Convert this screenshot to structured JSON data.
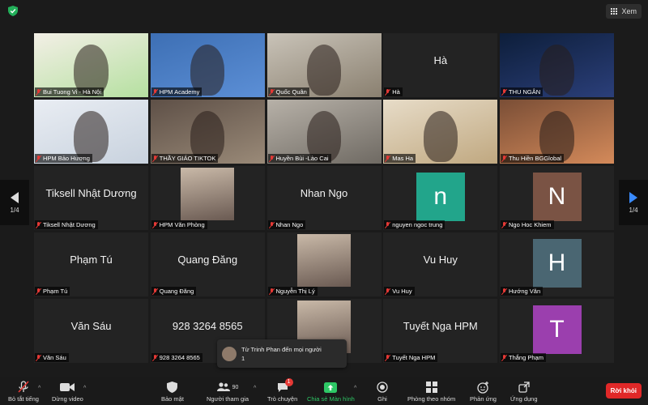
{
  "top_bar": {
    "view_label": "Xem"
  },
  "pager": {
    "left": "1/4",
    "right": "1/4"
  },
  "tiles": [
    {
      "name": "Bui Tuong Vi - Hà Nội",
      "kind": "video"
    },
    {
      "name": "HPM Academy",
      "kind": "video"
    },
    {
      "name": "Quốc Quân",
      "kind": "video"
    },
    {
      "name": "Hà",
      "kind": "text",
      "display": "Hà"
    },
    {
      "name": "THU NGÂN",
      "kind": "video"
    },
    {
      "name": "HPM Bảo Hương",
      "kind": "video"
    },
    {
      "name": "THẦY GIÁO TIKTOK",
      "kind": "video",
      "active": true
    },
    {
      "name": "Huyền Bùi -Lào Cai",
      "kind": "video"
    },
    {
      "name": "Mas Ha",
      "kind": "video"
    },
    {
      "name": "Thu Hiền BGGlobal",
      "kind": "video"
    },
    {
      "name": "Tiksell Nhật Dương",
      "kind": "text",
      "display": "Tiksell Nhật Dương"
    },
    {
      "name": "HPM Văn Phòng",
      "kind": "photo"
    },
    {
      "name": "Nhan Ngo",
      "kind": "text",
      "display": "Nhan Ngo"
    },
    {
      "name": "nguyen ngoc trung",
      "kind": "avatar",
      "letter": "n",
      "color": "#22a58b"
    },
    {
      "name": "Ngo Hoc Khiem",
      "kind": "avatar",
      "letter": "N",
      "color": "#7a5344"
    },
    {
      "name": "Phạm Tú",
      "kind": "text",
      "display": "Phạm Tú"
    },
    {
      "name": "Quang Đăng",
      "kind": "text",
      "display": "Quang Đăng"
    },
    {
      "name": "Nguyễn Thị Lý",
      "kind": "photo"
    },
    {
      "name": "Vu Huy",
      "kind": "text",
      "display": "Vu Huy"
    },
    {
      "name": "Hướng Văn",
      "kind": "avatar",
      "letter": "H",
      "color": "#4a6672"
    },
    {
      "name": "Văn Sáu",
      "kind": "text",
      "display": "Văn Sáu"
    },
    {
      "name": "928 3264 8565",
      "kind": "text",
      "display": "928 3264 8565"
    },
    {
      "name": "",
      "kind": "photo"
    },
    {
      "name": "Tuyết Nga HPM",
      "kind": "text",
      "display": "Tuyết Nga HPM"
    },
    {
      "name": "Thắng Phạm",
      "kind": "avatar",
      "letter": "T",
      "color": "#9b3fae"
    }
  ],
  "chat_toast": {
    "line1": "Từ Trinh Phan đến mọi người",
    "line2": "1"
  },
  "toolbar": {
    "mute": "Bỏ tắt tiếng",
    "video": "Dừng video",
    "security": "Bảo mật",
    "participants": "Người tham gia",
    "participants_count": "90",
    "chat": "Trò chuyện",
    "chat_badge": "1",
    "share": "Chia sẻ Màn hình",
    "record": "Ghi",
    "breakout": "Phòng theo nhóm",
    "reactions": "Phản ứng",
    "apps": "Ứng dụng",
    "leave": "Rời khỏi"
  }
}
